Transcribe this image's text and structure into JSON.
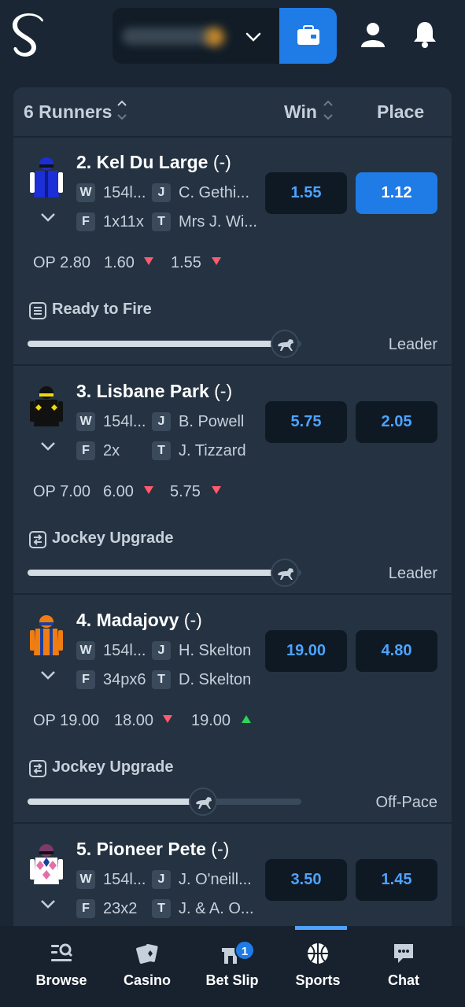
{
  "header": {
    "balance_hidden": "",
    "icons": [
      "logo",
      "chevron-down-icon",
      "wallet-icon",
      "user-icon",
      "bell-icon"
    ]
  },
  "list": {
    "runners_label": "6 Runners",
    "win_label": "Win",
    "place_label": "Place"
  },
  "runners": [
    {
      "name": "2. Kel Du Large",
      "sp": " (-)",
      "weight": "154l...",
      "jockey": "C. Gethi...",
      "form": "1x11x",
      "trainer": "Mrs J. Wi...",
      "win_odds": "1.55",
      "place_odds": "1.12",
      "place_selected": true,
      "op": "OP 2.80",
      "price1": "1.60",
      "price1_dir": "down",
      "price2": "1.55",
      "price2_dir": "down",
      "insight": "Ready to Fire",
      "pace": "Leader",
      "pace_level": 0.94,
      "silk_colors": [
        "#1c2ed6",
        "#ffffff"
      ]
    },
    {
      "name": "3. Lisbane Park",
      "sp": " (-)",
      "weight": "154l...",
      "jockey": "B. Powell",
      "form": "2x",
      "trainer": "J. Tizzard",
      "win_odds": "5.75",
      "place_odds": "2.05",
      "place_selected": false,
      "op": "OP 7.00",
      "price1": "6.00",
      "price1_dir": "down",
      "price2": "5.75",
      "price2_dir": "down",
      "insight": "Jockey Upgrade",
      "pace": "Leader",
      "pace_level": 0.94,
      "silk_colors": [
        "#111111",
        "#f2d90a"
      ]
    },
    {
      "name": "4. Madajovy",
      "sp": " (-)",
      "weight": "154l...",
      "jockey": "H. Skelton",
      "form": "34px6",
      "trainer": "D. Skelton",
      "win_odds": "19.00",
      "place_odds": "4.80",
      "place_selected": false,
      "op": "OP 19.00",
      "price1": "18.00",
      "price1_dir": "down",
      "price2": "19.00",
      "price2_dir": "up",
      "insight": "Jockey Upgrade",
      "pace": "Off-Pace",
      "pace_level": 0.64,
      "silk_colors": [
        "#ef7d12",
        "#1c3f9c"
      ]
    },
    {
      "name": "5. Pioneer Pete",
      "sp": " (-)",
      "weight": "154l...",
      "jockey": "J. O'neill...",
      "form": "23x2",
      "trainer": "J. & A. O...",
      "win_odds": "3.50",
      "place_odds": "1.45",
      "place_selected": false,
      "silk_colors": [
        "#ffffff",
        "#e46ea8"
      ]
    }
  ],
  "tag_labels": {
    "w": "W",
    "j": "J",
    "f": "F",
    "t": "T"
  },
  "nav": {
    "items": [
      {
        "label": "Browse",
        "icon": "browse-icon"
      },
      {
        "label": "Casino",
        "icon": "casino-cards-icon"
      },
      {
        "label": "Bet Slip",
        "icon": "bet-slip-icon",
        "badge": "1"
      },
      {
        "label": "Sports",
        "icon": "basketball-icon",
        "active": true
      },
      {
        "label": "Chat",
        "icon": "chat-icon"
      }
    ]
  }
}
